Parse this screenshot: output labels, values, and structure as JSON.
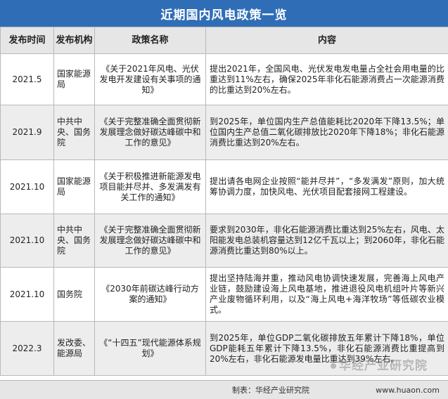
{
  "title": "近期国内风电政策一览",
  "headers": {
    "date": "发布时间",
    "org": "发布机构",
    "name": "政策名称",
    "content": "内容"
  },
  "rows": [
    {
      "date": "2021.5",
      "org": "国家能源局",
      "name": "《关于2021年风电、光伏发电开发建设有关事项的通知》",
      "content": "提出2021年，全国风电、光伏发电发电量占全社会用电量的比重达到11%左右，确保2025年非化石能源消费占一次能源消费的比重达到20%左右。"
    },
    {
      "date": "2021.9",
      "org": "中共中央、国务院",
      "name": "《关于完整准确全面贯彻新发展理念做好碳达峰碳中和工作的意见》",
      "content": "到2025年，单位国内生产总值能耗比2020年下降13.5%；单位国内生产总值二氧化碳排放比2020年下降18%；非化石能源消费比重达到20%左右。"
    },
    {
      "date": "2021.10",
      "org": "国家能源局",
      "name": "《关于积极推进新能源发电项目能并尽并、多发满发有关工作的通知》",
      "content": "提出请各电网企业按照“能并尽并”，“多发满发”原则，加大统筹协调力度，加快风电、光伏项目配套接网工程建设。"
    },
    {
      "date": "2021.10",
      "org": "中共中央、国务院",
      "name": "《关于完整准确全面贯彻新发展理念做好碳达峰碳中和工作的意见》",
      "content": "要求到2030年，非化石能源消费比重达到25%左右，风电、太阳能发电总装机容量达到12亿千瓦以上；到2060年，非化石能源消费比重达到80%以上。"
    },
    {
      "date": "2021.10",
      "org": "国务院",
      "name": "《2030年前碳达峰行动方案的通知》",
      "content": "提出坚持陆海并重，推动风电协调快速发展，完善海上风电产业链，鼓励建设海上风电基地，推进退役风电机组叶片等新兴产业废物循环利用，以及“海上风电+海洋牧场”等低碳农业模式。"
    },
    {
      "date": "2022.3",
      "org": "发改委、能源局",
      "name": "《“十四五”现代能源体系规划》",
      "content": "到2025年，单位GDP二氧化碳排放五年累计下降18%，单位GDP能耗五年累计下降13.5%，非化石能源消费比重提高到20%左右，非化石能源发电量比重达到39%左右。"
    }
  ],
  "footer": {
    "source": "制表：华经产业研究院",
    "url": "www.huaon.com"
  },
  "watermark": "华经产业研究院"
}
